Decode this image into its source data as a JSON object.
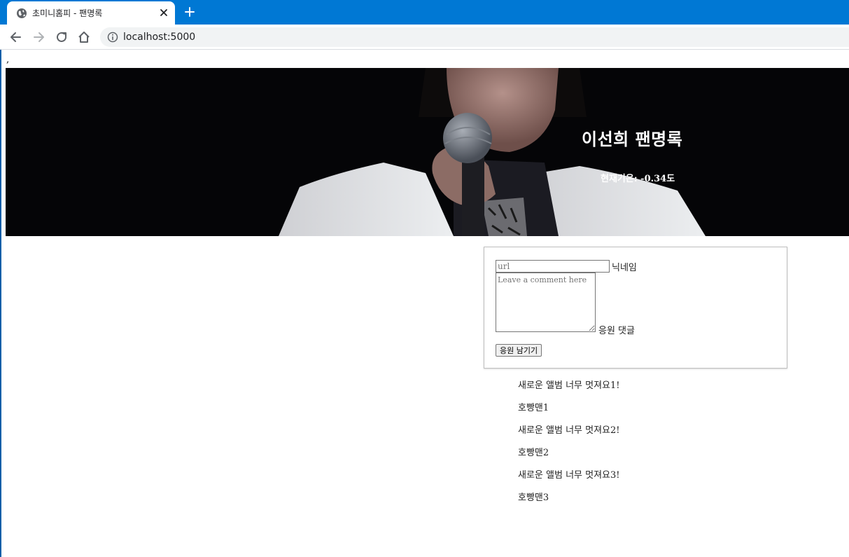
{
  "browser": {
    "tab_title": "초미니홈피 - 팬명록",
    "url": "localhost:5000"
  },
  "page": {
    "stray_text": ",",
    "hero": {
      "title": "이선희 팬명록",
      "temp_prefix": "현재기온: ",
      "temp_value": "-0.34",
      "temp_suffix": "도"
    },
    "form": {
      "url_placeholder": "url",
      "nickname_label": "닉네임",
      "comment_placeholder": "Leave a comment here",
      "comment_label": "응원 댓글",
      "submit_label": "응원 남기기"
    },
    "comments": [
      {
        "text": "새로운 앨범 너무 멋져요1!",
        "author": "호빵맨1"
      },
      {
        "text": "새로운 앨범 너무 멋져요2!",
        "author": "호빵맨2"
      },
      {
        "text": "새로운 앨범 너무 멋져요3!",
        "author": "호빵맨3"
      }
    ]
  },
  "colors": {
    "tabstrip": "#0078d4",
    "hero_bg": "#050507"
  }
}
